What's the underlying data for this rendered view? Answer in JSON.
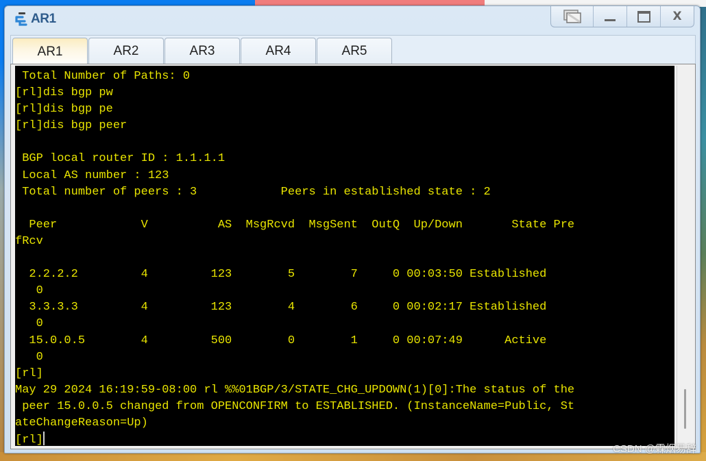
{
  "window": {
    "title": "AR1",
    "controls": {
      "restore_icon": "restore-windows-icon",
      "minimize_label": "_",
      "maximize_label": "▭",
      "close_label": "X"
    }
  },
  "tabs": [
    {
      "label": "AR1",
      "active": true
    },
    {
      "label": "AR2",
      "active": false
    },
    {
      "label": "AR3",
      "active": false
    },
    {
      "label": "AR4",
      "active": false
    },
    {
      "label": "AR5",
      "active": false
    }
  ],
  "terminal": {
    "text_color": "#e8e400",
    "background": "#000000",
    "lines": [
      " Total Number of Paths: 0",
      "[rl]dis bgp pw",
      "[rl]dis bgp pe",
      "[rl]dis bgp peer",
      "",
      " BGP local router ID : 1.1.1.1",
      " Local AS number : 123",
      " Total number of peers : 3            Peers in established state : 2",
      "",
      "  Peer            V          AS  MsgRcvd  MsgSent  OutQ  Up/Down       State Pre",
      "fRcv",
      "",
      "  2.2.2.2         4         123        5        7     0 00:03:50 Established",
      "   0",
      "  3.3.3.3         4         123        4        6     0 00:02:17 Established",
      "   0",
      "  15.0.0.5        4         500        0        1     0 00:07:49      Active",
      "   0",
      "[rl]",
      "May 29 2024 16:19:59-08:00 rl %%01BGP/3/STATE_CHG_UPDOWN(1)[0]:The status of the",
      " peer 15.0.0.5 changed from OPENCONFIRM to ESTABLISHED. (InstanceName=Public, St",
      "ateChangeReason=Up)"
    ],
    "prompt": "[rl]",
    "bgp_summary": {
      "router_id": "1.1.1.1",
      "local_as": "123",
      "total_peers": 3,
      "established_peers": 2,
      "columns": [
        "Peer",
        "V",
        "AS",
        "MsgRcvd",
        "MsgSent",
        "OutQ",
        "Up/Down",
        "State",
        "PrefRcv"
      ],
      "peers": [
        [
          "2.2.2.2",
          "4",
          "123",
          "5",
          "7",
          "0",
          "00:03:50",
          "Established",
          "0"
        ],
        [
          "3.3.3.3",
          "4",
          "123",
          "4",
          "6",
          "0",
          "00:02:17",
          "Established",
          "0"
        ],
        [
          "15.0.0.5",
          "4",
          "500",
          "0",
          "1",
          "0",
          "00:07:49",
          "Active",
          "0"
        ]
      ]
    }
  },
  "watermark": "CSDN @霖烟易辞"
}
